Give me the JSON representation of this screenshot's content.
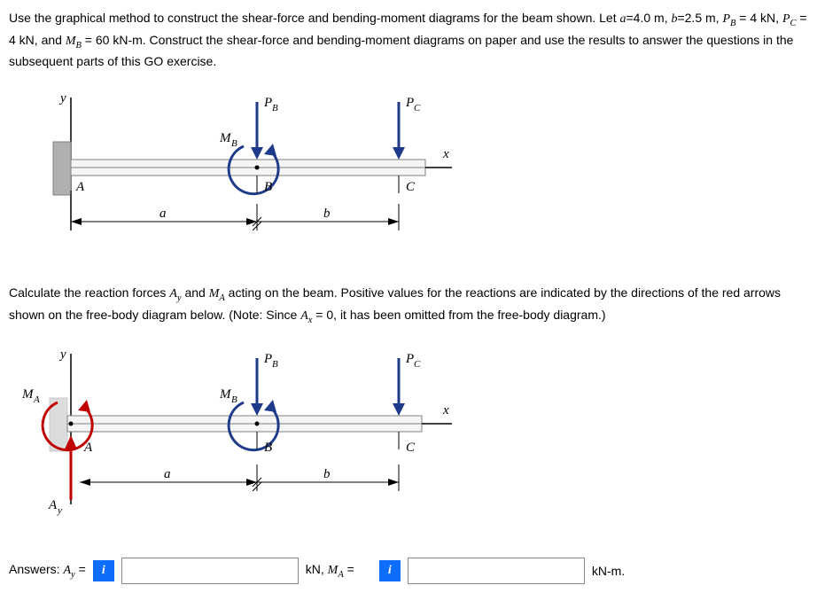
{
  "problem": {
    "text": "Use the graphical method to construct the shear-force and bending-moment diagrams for the beam shown. Let a=4.0 m, b=2.5 m, PB = 4 kN, PC = 4 kN, and MB = 60 kN-m. Construct the shear-force and bending-moment diagrams on paper and use the results to answer the questions in the subsequent parts of this GO exercise."
  },
  "diagram1": {
    "y": "y",
    "x": "x",
    "PB": "PB",
    "PC": "PC",
    "MB": "MB",
    "A": "A",
    "B": "B",
    "C": "C",
    "a": "a",
    "b": "b"
  },
  "instruction": {
    "text": "Calculate the reaction forces Ay and MA acting on the beam. Positive values for the reactions are indicated by the directions of the red arrows shown on the free-body diagram below. (Note: Since Ax = 0, it has been omitted from the free-body diagram.)"
  },
  "diagram2": {
    "y": "y",
    "x": "x",
    "PB": "PB",
    "PC": "PC",
    "MB": "MB",
    "MA": "MA",
    "A": "A",
    "B": "B",
    "C": "C",
    "a": "a",
    "b": "b",
    "Ay": "Ay"
  },
  "answers": {
    "prefix": "Answers:",
    "ay_label": "Ay =",
    "ay_value": "",
    "ay_unit": "kN,",
    "ma_label": "MA =",
    "ma_value": "",
    "ma_unit": "kN-m."
  }
}
